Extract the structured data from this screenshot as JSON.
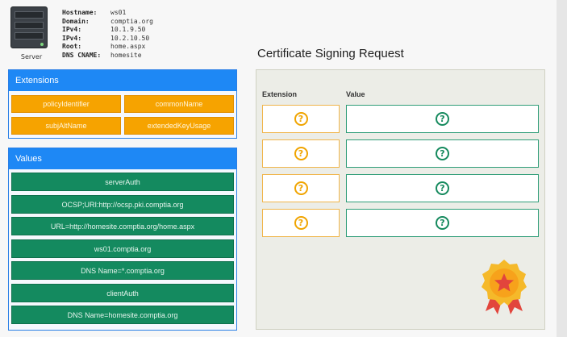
{
  "server": {
    "caption": "Server",
    "fields": [
      {
        "key": "Hostname:",
        "value": "ws01"
      },
      {
        "key": "Domain:",
        "value": "comptia.org"
      },
      {
        "key": "IPv4:",
        "value": "10.1.9.50"
      },
      {
        "key": "IPv4:",
        "value": "10.2.10.50"
      },
      {
        "key": "Root:",
        "value": "home.aspx"
      },
      {
        "key": "DNS CNAME:",
        "value": "homesite"
      }
    ]
  },
  "extensions": {
    "title": "Extensions",
    "items": [
      "policyIdentifier",
      "commonName",
      "subjAltName",
      "extendedKeyUsage"
    ]
  },
  "values": {
    "title": "Values",
    "items": [
      "serverAuth",
      "OCSP;URI:http://ocsp.pki.comptia.org",
      "URL=http://homesite.comptia.org/home.aspx",
      "ws01.comptia.org",
      "DNS Name=*.comptia.org",
      "clientAuth",
      "DNS Name=homesite.comptia.org"
    ]
  },
  "csr": {
    "title": "Certificate Signing Request",
    "col_extension": "Extension",
    "col_value": "Value",
    "placeholder_glyph": "?"
  },
  "colors": {
    "accent_blue": "#1e88f5",
    "extension_orange": "#f6a300",
    "value_green": "#148a5f"
  },
  "icons": [
    "server-icon",
    "question-mark-icon",
    "award-badge-icon"
  ]
}
